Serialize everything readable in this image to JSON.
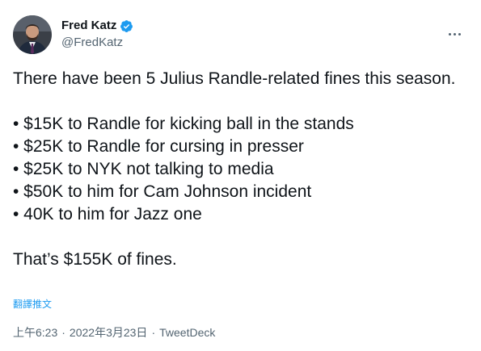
{
  "author": {
    "display_name": "Fred Katz",
    "handle": "@FredKatz",
    "verified": true,
    "avatar_icon": "profile-photo"
  },
  "menu": {
    "icon": "more-icon"
  },
  "tweet": {
    "intro": "There have been 5 Julius Randle-related fines this season.",
    "fines": [
      "• $15K to Randle for kicking ball in the stands",
      "• $25K to Randle for cursing in presser",
      "• $25K to NYK not talking to media",
      "• $50K to him for Cam Johnson incident",
      "• 40K to him for Jazz one"
    ],
    "conclusion": "That’s $155K of fines."
  },
  "translate_label": "翻譯推文",
  "meta": {
    "time": "上午6:23",
    "separator": "·",
    "date": "2022年3月23日",
    "source": "TweetDeck"
  },
  "colors": {
    "text": "#0f1419",
    "secondary": "#536471",
    "accent": "#1d9bf0"
  }
}
